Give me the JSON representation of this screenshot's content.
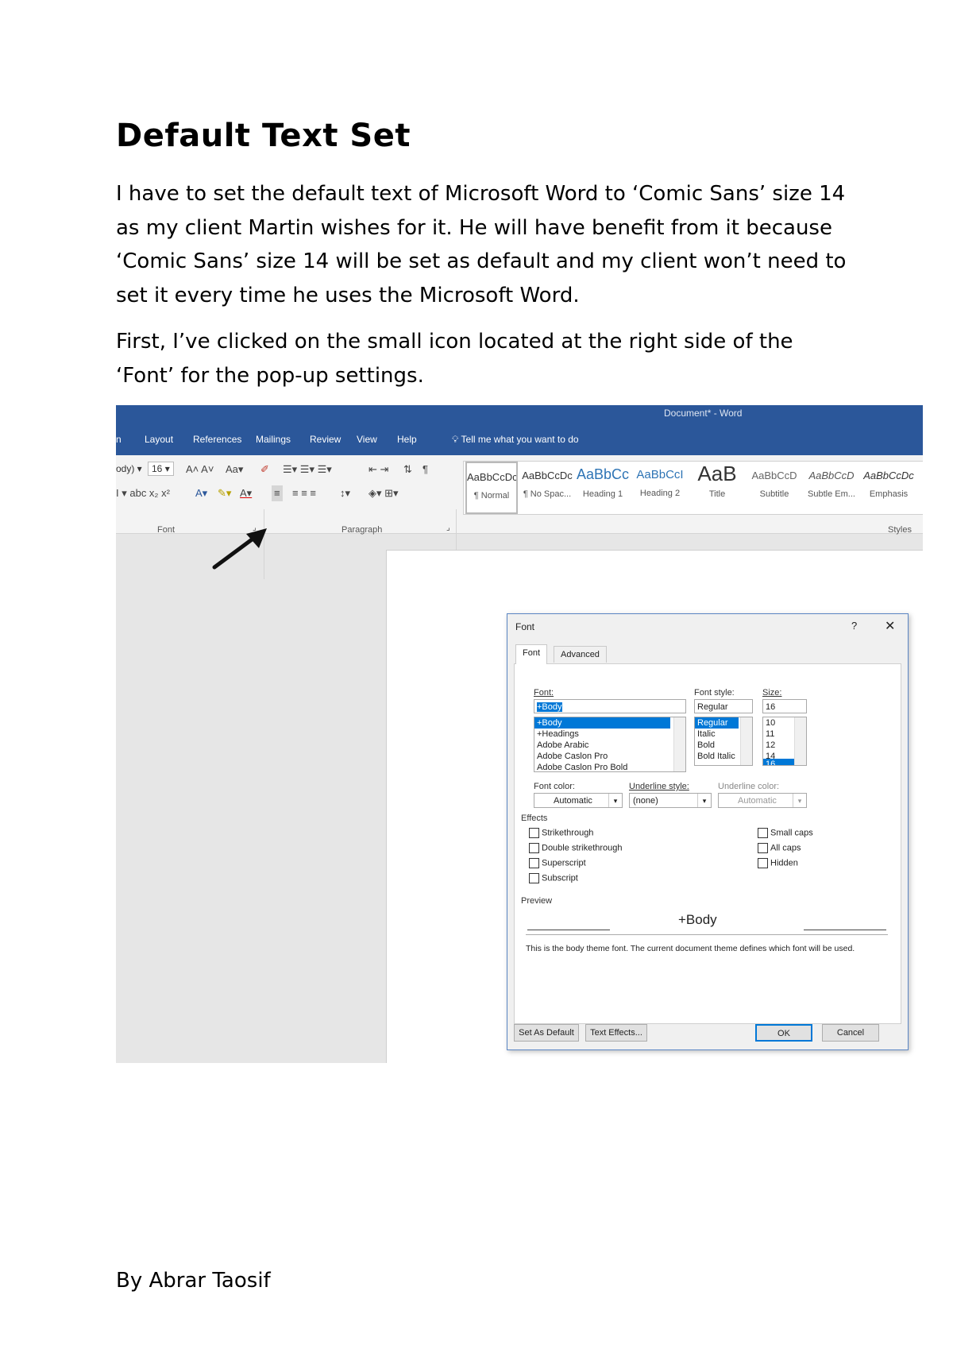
{
  "document": {
    "title": "Default Text Set",
    "paragraph1": "I have to set the default text of Microsoft Word to ‘Comic Sans’ size 14 as my client Martin wishes for it. He will have benefit from it because ‘Comic Sans’ size 14 will be set as default and my client won’t need to set it every time he uses the Microsoft Word.",
    "paragraph2": "First, I’ve clicked on the small icon located at the right side of the ‘Font’ for the pop-up settings.",
    "byline": "By Abrar Taosif"
  },
  "word": {
    "window_title": "Document* - Word",
    "tabs": [
      "n",
      "Layout",
      "References",
      "Mailings",
      "Review",
      "View",
      "Help"
    ],
    "tell_me": "Tell me what you want to do",
    "font_name_partial": "ody)",
    "font_size": "16",
    "group_labels": {
      "font": "Font",
      "paragraph": "Paragraph",
      "styles": "Styles"
    },
    "styles": [
      {
        "sample": "AaBbCcDc",
        "name": "¶ Normal"
      },
      {
        "sample": "AaBbCcDc",
        "name": "¶ No Spac..."
      },
      {
        "sample": "AaBbCc",
        "name": "Heading 1"
      },
      {
        "sample": "AaBbCcI",
        "name": "Heading 2"
      },
      {
        "sample": "AaB",
        "name": "Title"
      },
      {
        "sample": "AaBbCcD",
        "name": "Subtitle"
      },
      {
        "sample": "AaBbCcD",
        "name": "Subtle Em..."
      },
      {
        "sample": "AaBbCcDc",
        "name": "Emphasis"
      }
    ]
  },
  "font_dialog": {
    "title": "Font",
    "help": "?",
    "close": "✕",
    "tabs": [
      "Font",
      "Advanced"
    ],
    "font_label": "Font:",
    "font_value": "+Body",
    "font_list": [
      "+Body",
      "+Headings",
      "Adobe Arabic",
      "Adobe Caslon Pro",
      "Adobe Caslon Pro Bold"
    ],
    "style_label": "Font style:",
    "style_value": "Regular",
    "style_list": [
      "Regular",
      "Italic",
      "Bold",
      "Bold Italic"
    ],
    "size_label": "Size:",
    "size_value": "16",
    "size_list": [
      "10",
      "11",
      "12",
      "14",
      "16"
    ],
    "font_color_label": "Font color:",
    "font_color_value": "Automatic",
    "underline_style_label": "Underline style:",
    "underline_style_value": "(none)",
    "underline_color_label": "Underline color:",
    "underline_color_value": "Automatic",
    "effects_label": "Effects",
    "effects_left": [
      "Strikethrough",
      "Double strikethrough",
      "Superscript",
      "Subscript"
    ],
    "effects_right": [
      "Small caps",
      "All caps",
      "Hidden"
    ],
    "preview_label": "Preview",
    "preview_sample": "+Body",
    "preview_note": "This is the body theme font. The current document theme defines which font will be used.",
    "buttons": {
      "set_default": "Set As Default",
      "text_effects": "Text Effects...",
      "ok": "OK",
      "cancel": "Cancel"
    }
  },
  "colors": {
    "ribbon_blue": "#2b579a",
    "selection_blue": "#0078d7"
  }
}
